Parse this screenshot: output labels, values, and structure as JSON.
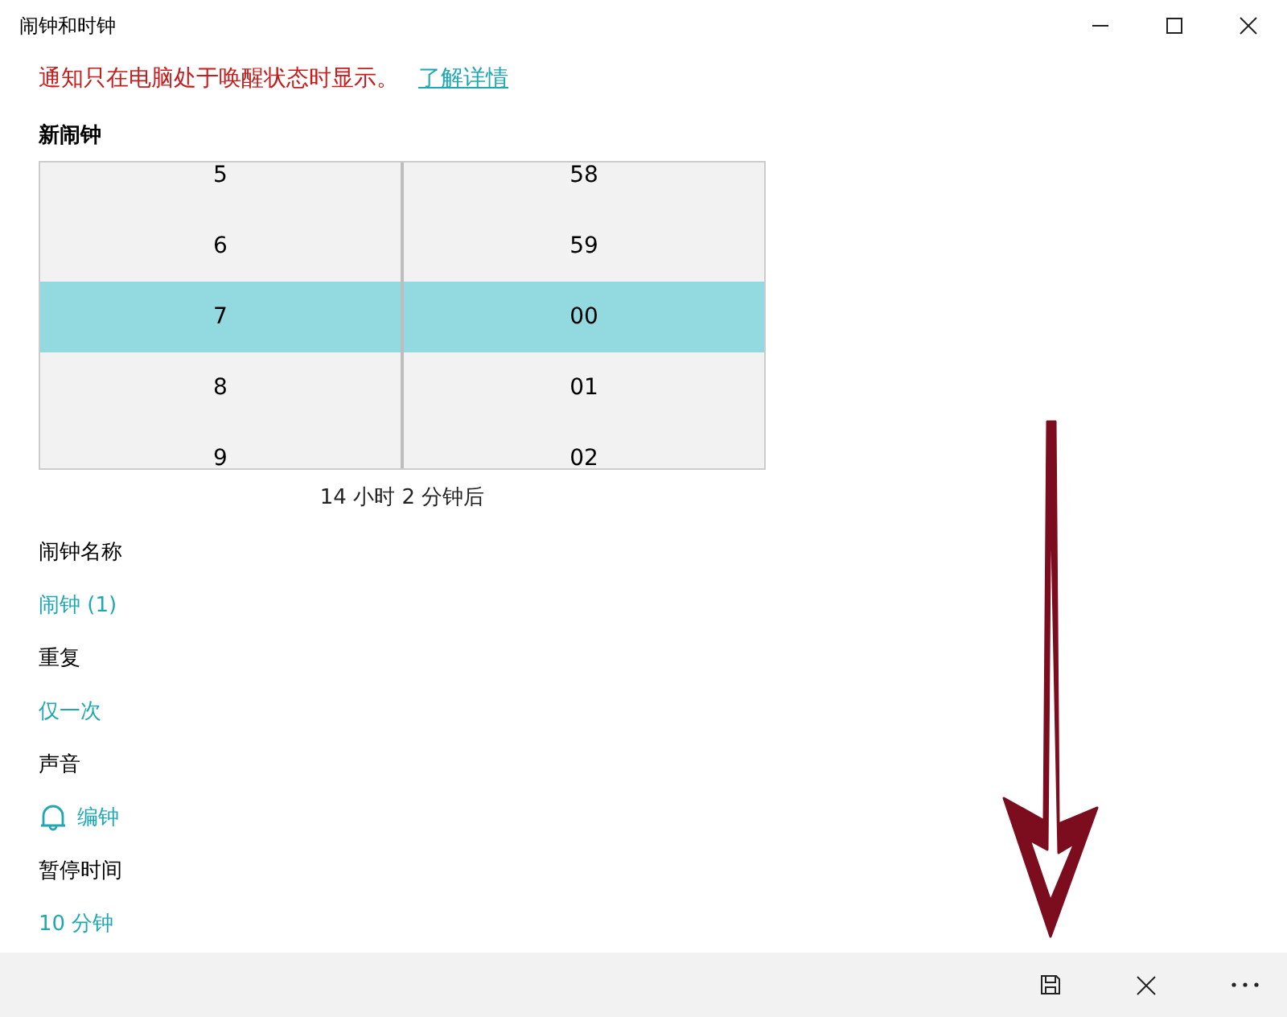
{
  "window": {
    "title": "闹钟和时钟"
  },
  "notice": {
    "text": "通知只在电脑处于唤醒状态时显示。",
    "link": "了解详情"
  },
  "heading": "新闹钟",
  "picker": {
    "hours": [
      {
        "label": "5",
        "selected": false
      },
      {
        "label": "6",
        "selected": false
      },
      {
        "label": "7",
        "selected": true
      },
      {
        "label": "8",
        "selected": false
      },
      {
        "label": "9",
        "selected": false
      }
    ],
    "minutes": [
      {
        "label": "58",
        "selected": false
      },
      {
        "label": "59",
        "selected": false
      },
      {
        "label": "00",
        "selected": true
      },
      {
        "label": "01",
        "selected": false
      },
      {
        "label": "02",
        "selected": false
      }
    ],
    "caption": "14 小时 2 分钟后"
  },
  "fields": [
    {
      "kind": "plain",
      "label": "闹钟名称",
      "value": "闹钟 (1)"
    },
    {
      "kind": "plain",
      "label": "重复",
      "value": "仅一次"
    },
    {
      "kind": "sound",
      "label": "声音",
      "value": "编钟"
    },
    {
      "kind": "plain",
      "label": "暂停时间",
      "value": "10 分钟"
    }
  ],
  "command_bar": [
    {
      "kind": "save"
    },
    {
      "kind": "close"
    },
    {
      "kind": "more"
    }
  ]
}
